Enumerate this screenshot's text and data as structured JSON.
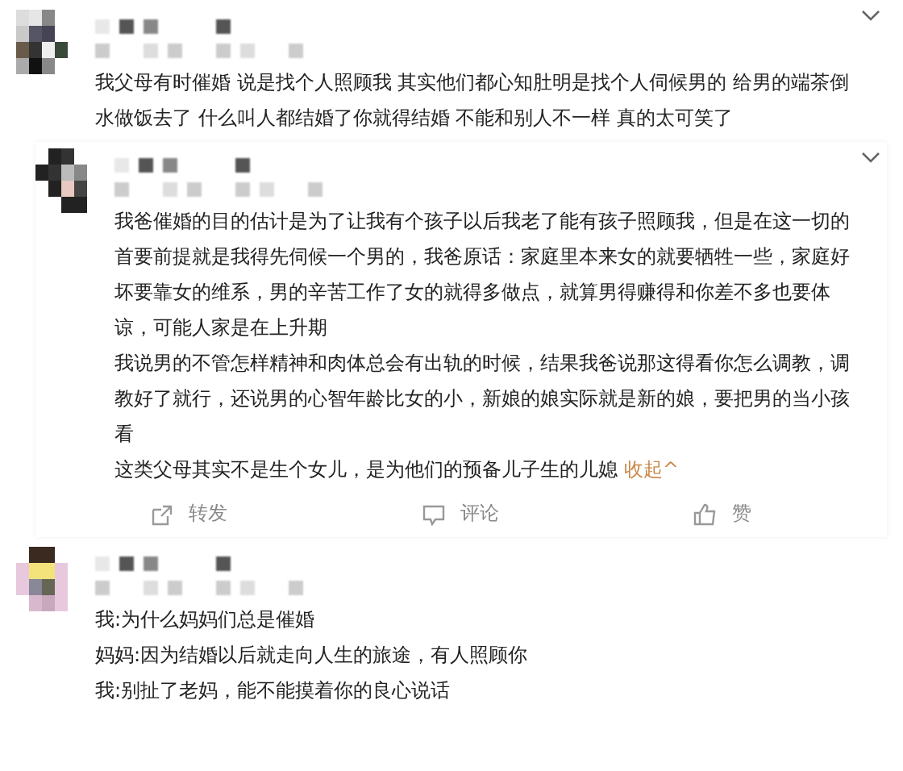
{
  "comments": [
    {
      "paragraphs": [
        "我父母有时催婚 说是找个人照顾我 其实他们都心知肚明是找个人伺候男的 给男的端茶倒水做饭去了 什么叫人都结婚了你就得结婚 不能和别人不一样 真的太可笑了"
      ],
      "has_menu": true,
      "boxed": false
    },
    {
      "paragraphs": [
        "我爸催婚的目的估计是为了让我有个孩子以后我老了能有孩子照顾我，但是在这一切的首要前提就是我得先伺候一个男的，我爸原话：家庭里本来女的就要牺牲一些，家庭好坏要靠女的维系，男的辛苦工作了女的就得多做点，就算男得赚得和你差不多也要体谅，可能人家是在上升期",
        "我说男的不管怎样精神和肉体总会有出轨的时候，结果我爸说那这得看你怎么调教，调教好了就行，还说男的心智年龄比女的小，新娘的娘实际就是新的娘，要把男的当小孩看",
        "这类父母其实不是生个女儿，是为他们的预备儿子生的儿媳"
      ],
      "collapse_link": "收起^",
      "has_menu": true,
      "boxed": true,
      "actions": [
        {
          "kind": "share",
          "label": "转发"
        },
        {
          "kind": "comment",
          "label": "评论"
        },
        {
          "kind": "like",
          "label": "赞"
        }
      ]
    },
    {
      "paragraphs": [
        "我:为什么妈妈们总是催婚",
        "妈妈:因为结婚以后就走向人生的旅途，有人照顾你",
        "我:别扯了老妈，能不能摸着你的良心说话"
      ],
      "has_menu": false,
      "boxed": false
    }
  ]
}
